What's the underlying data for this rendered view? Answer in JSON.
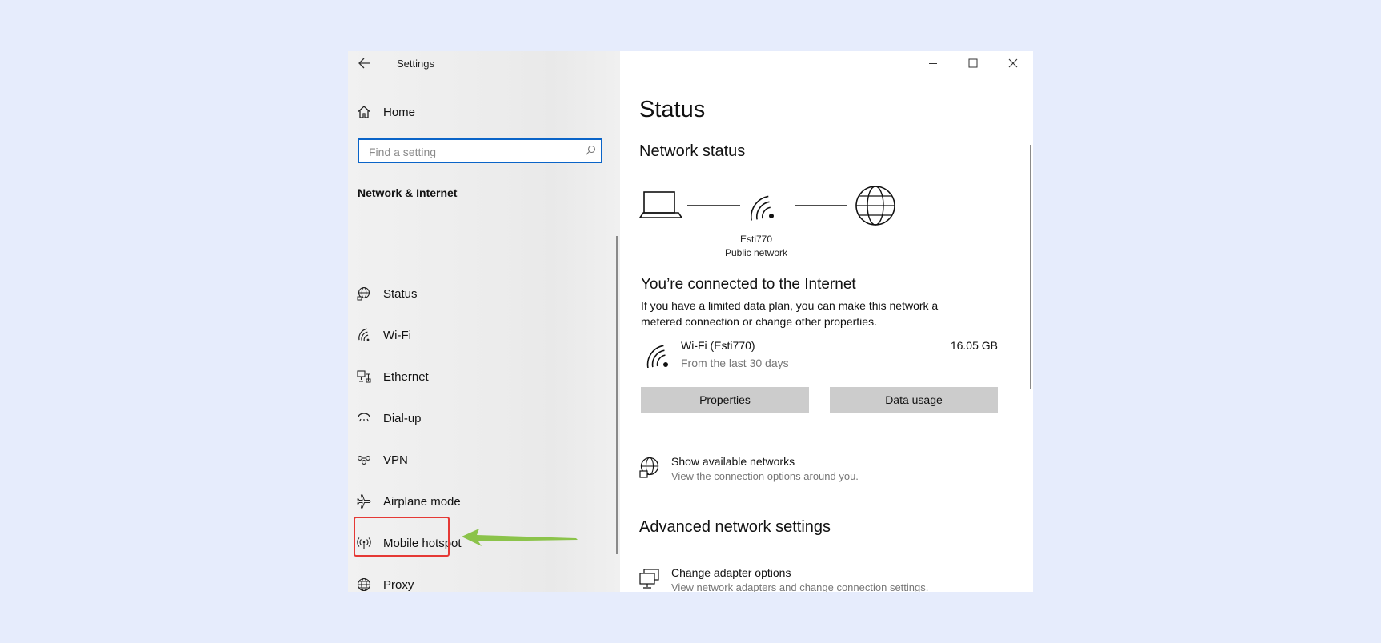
{
  "window": {
    "title": "Settings"
  },
  "sidebar": {
    "home_label": "Home",
    "search_placeholder": "Find a setting",
    "section_header": "Network & Internet",
    "items": [
      {
        "label": "Status",
        "icon": "globe-status-icon"
      },
      {
        "label": "Wi-Fi",
        "icon": "wifi-icon"
      },
      {
        "label": "Ethernet",
        "icon": "ethernet-icon"
      },
      {
        "label": "Dial-up",
        "icon": "dialup-icon"
      },
      {
        "label": "VPN",
        "icon": "vpn-icon"
      },
      {
        "label": "Airplane mode",
        "icon": "airplane-icon"
      },
      {
        "label": "Mobile hotspot",
        "icon": "hotspot-icon"
      },
      {
        "label": "Proxy",
        "icon": "globe-icon"
      }
    ]
  },
  "main": {
    "title": "Status",
    "network_status_heading": "Network status",
    "network_name": "Esti770",
    "network_type": "Public network",
    "connected_title": "You’re connected to the Internet",
    "connected_desc": "If you have a limited data plan, you can make this network a metered connection or change other properties.",
    "wifi_name": "Wi-Fi (Esti770)",
    "wifi_period": "From the last 30 days",
    "wifi_usage": "16.05 GB",
    "properties_label": "Properties",
    "data_usage_label": "Data usage",
    "show_networks_title": "Show available networks",
    "show_networks_desc": "View the connection options around you.",
    "advanced_heading": "Advanced network settings",
    "adapter_title": "Change adapter options",
    "adapter_desc": "View network adapters and change connection settings."
  },
  "colors": {
    "accent": "#0a64c8",
    "highlight": "#e53935",
    "arrow": "#8bc34a",
    "background": "#e6ecfc"
  }
}
